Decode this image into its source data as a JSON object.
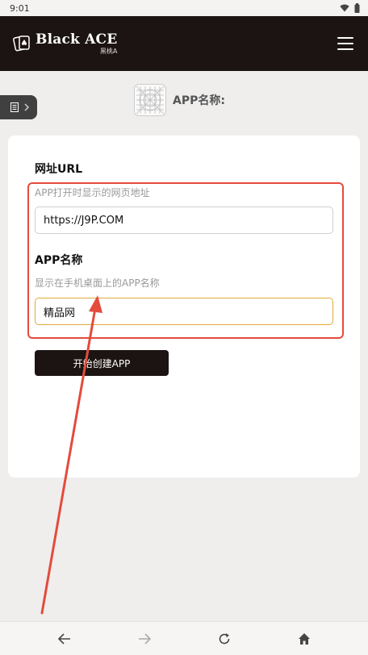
{
  "status_bar": {
    "time": "9:01"
  },
  "header": {
    "brand_name": "Black ACE",
    "brand_sub": "黑桃A",
    "menu_icon": "hamburger-icon"
  },
  "app_title": "APP名称:",
  "form": {
    "url_label": "网址URL",
    "url_hint": "APP打开时显示的网页地址",
    "url_value": "https://J9P.COM",
    "name_label": "APP名称",
    "name_hint": "显示在手机桌面上的APP名称",
    "name_value": "精品网",
    "create_button": "开始创建APP"
  },
  "colors": {
    "header_bg": "#1c1412",
    "annotation_red": "#e44b3c",
    "focus_border": "#e1a93a"
  }
}
